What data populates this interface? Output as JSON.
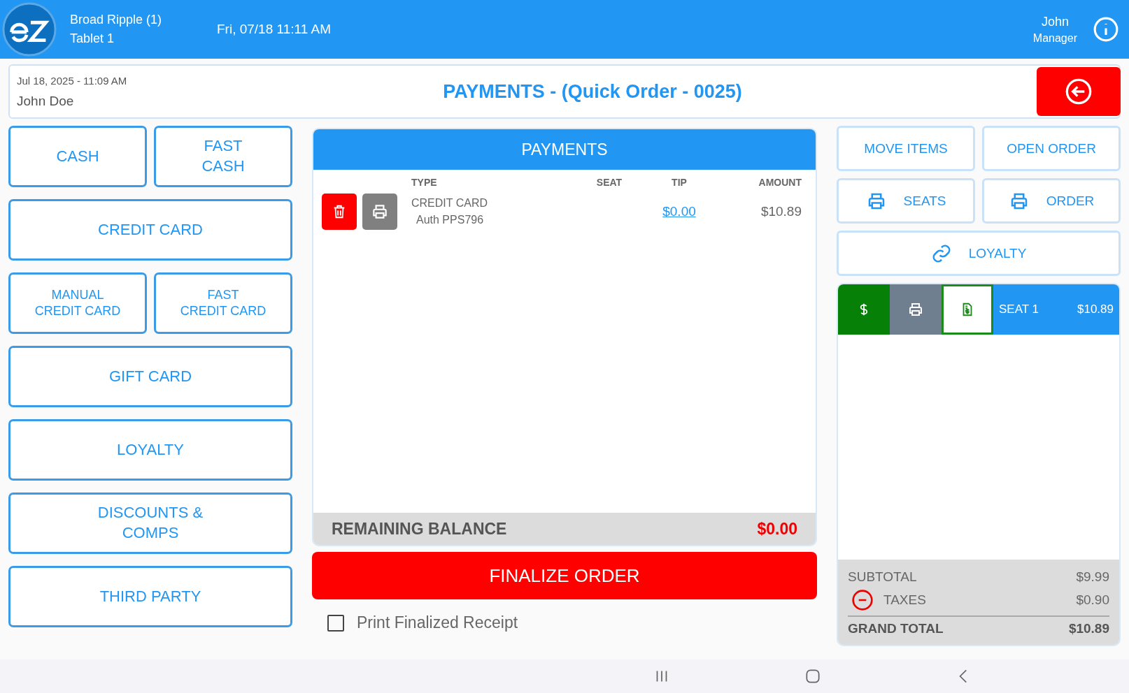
{
  "top_bar": {
    "location": "Broad Ripple (1)",
    "device": "Tablet 1",
    "datetime": "Fri, 07/18 11:11 AM",
    "user_name": "John",
    "user_role": "Manager"
  },
  "order_header": {
    "created": "Jul 18, 2025  - 11:09 AM",
    "customer": "John Doe",
    "title": "PAYMENTS - (Quick Order - 0025)"
  },
  "payment_methods": [
    [
      {
        "label": "CASH",
        "kind": "large"
      },
      {
        "label": "FAST\nCASH",
        "kind": "large"
      }
    ],
    [
      {
        "label": "CREDIT CARD",
        "kind": "large"
      }
    ],
    [
      {
        "label": "MANUAL\nCREDIT CARD",
        "kind": "small"
      },
      {
        "label": "FAST\nCREDIT CARD",
        "kind": "small"
      }
    ],
    [
      {
        "label": "GIFT CARD",
        "kind": "large"
      }
    ],
    [
      {
        "label": "LOYALTY",
        "kind": "large"
      }
    ],
    [
      {
        "label": "DISCOUNTS &\nCOMPS",
        "kind": "large"
      }
    ],
    [
      {
        "label": "THIRD PARTY",
        "kind": "large"
      }
    ]
  ],
  "payments": {
    "title": "PAYMENTS",
    "columns": [
      "TYPE",
      "SEAT",
      "TIP",
      "AMOUNT"
    ],
    "rows": [
      {
        "type": "CREDIT CARD",
        "auth": "Auth PPS796",
        "tip": "$0.00",
        "amount": "$10.89"
      }
    ],
    "remaining_label": "REMAINING BALANCE",
    "remaining_value": "$0.00"
  },
  "finalize_button": "FINALIZE ORDER",
  "print_receipt": {
    "label": "Print Finalized Receipt",
    "checked": false
  },
  "actions": [
    [
      {
        "label": "MOVE ITEMS",
        "kind": "plain"
      },
      {
        "label": "OPEN ORDER",
        "kind": "plain"
      }
    ],
    [
      {
        "label": "SEATS",
        "kind": "printer"
      },
      {
        "label": "ORDER",
        "kind": "printer"
      }
    ],
    [
      {
        "label": "LOYALTY",
        "kind": "link"
      }
    ]
  ],
  "seats": [
    {
      "label": "SEAT 1",
      "amount": "$10.89"
    }
  ],
  "totals": {
    "subtotal_label": "SUBTOTAL",
    "subtotal": "$9.99",
    "taxes_label": "TAXES",
    "taxes": "$0.90",
    "grand_total_label": "GRAND TOTAL",
    "grand_total": "$10.89"
  }
}
